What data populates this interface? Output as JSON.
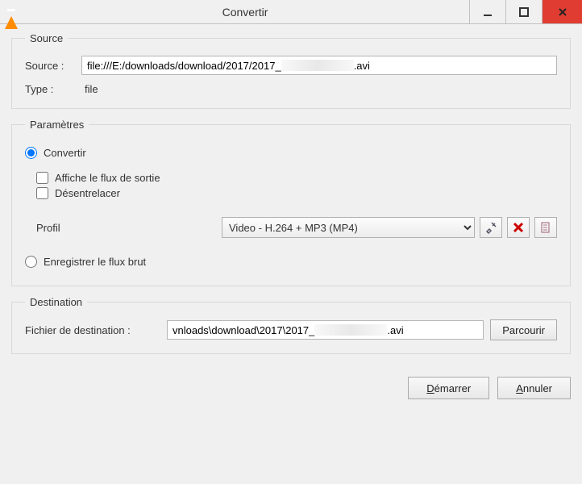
{
  "window": {
    "title": "Convertir"
  },
  "source": {
    "legend": "Source",
    "source_label": "Source :",
    "source_value_prefix": "file:///E:/downloads/download/2017/2017_",
    "source_value_suffix": ".avi",
    "type_label": "Type :",
    "type_value": "file"
  },
  "params": {
    "legend": "Paramètres",
    "convert_label": "Convertir",
    "show_output_label": "Affiche le flux de sortie",
    "deinterlace_label": "Désentrelacer",
    "profile_label": "Profil",
    "profile_value": "Video - H.264 + MP3 (MP4)",
    "raw_label": "Enregistrer le flux brut"
  },
  "destination": {
    "legend": "Destination",
    "dest_label": "Fichier de destination :",
    "dest_value_prefix": "vnloads\\download\\2017\\2017_",
    "dest_value_suffix": ".avi",
    "browse_label": "Parcourir"
  },
  "footer": {
    "start_label": "Démarrer",
    "cancel_label": "Annuler"
  }
}
